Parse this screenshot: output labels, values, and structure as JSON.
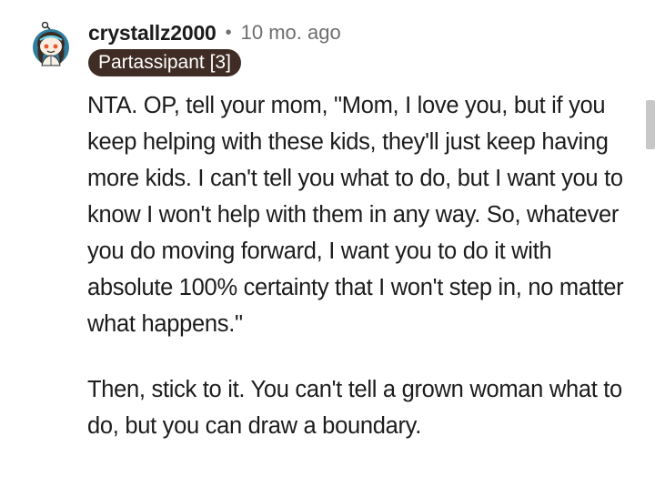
{
  "comment": {
    "author": "crystallz2000",
    "separator": "•",
    "timestamp": "10 mo. ago",
    "flair": "Partassipant [3]",
    "avatar_icon": "snoo-avatar-icon",
    "paragraphs": [
      "NTA. OP, tell your mom, \"Mom, I love you, but if you keep helping with these kids, they'll just keep having more kids. I can't tell you what to do, but I want you to know I won't help with them in any way. So, whatever you do moving forward, I want you to do it with absolute 100% certainty that I won't step in, no matter what happens.\"",
      "Then, stick to it. You can't tell a grown woman what to do, but you can draw a boundary."
    ]
  },
  "colors": {
    "flair_bg": "#3f2d25",
    "username": "#1c1c1c",
    "meta": "#6e6e6e",
    "scrollbar": "#c7c7c7"
  }
}
